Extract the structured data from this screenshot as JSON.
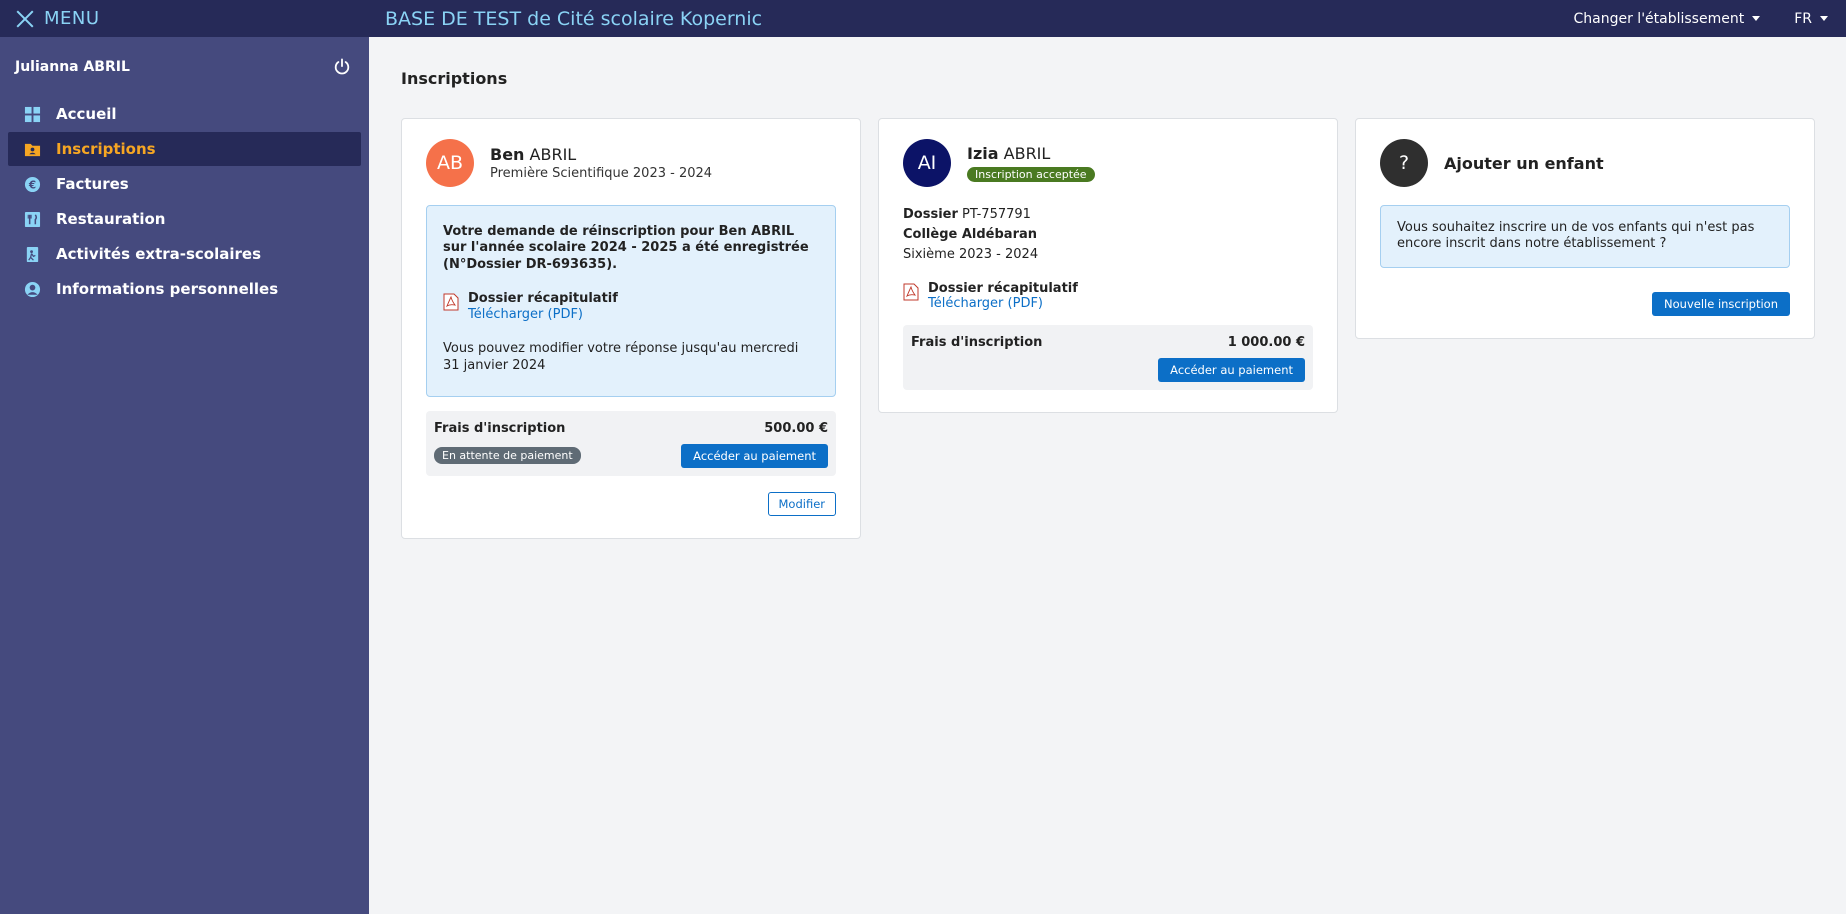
{
  "sidebar": {
    "menu_label": "MENU",
    "user_name": "Julianna ABRIL",
    "items": [
      {
        "label": "Accueil",
        "icon": "dashboard-icon"
      },
      {
        "label": "Inscriptions",
        "icon": "folder-user-icon",
        "active": true
      },
      {
        "label": "Factures",
        "icon": "euro-coin-icon"
      },
      {
        "label": "Restauration",
        "icon": "restaurant-icon"
      },
      {
        "label": "Activités extra-scolaires",
        "icon": "activity-icon"
      },
      {
        "label": "Informations personnelles",
        "icon": "person-icon"
      }
    ]
  },
  "topbar": {
    "title": "BASE DE TEST de Cité scolaire Kopernic",
    "change_school": "Changer l'établissement",
    "language": "FR"
  },
  "main": {
    "title": "Inscriptions",
    "cards": [
      {
        "initials": "AB",
        "first_name": "Ben",
        "last_name": "ABRIL",
        "class_year": "Première Scientifique 2023 - 2024",
        "message": "Votre demande de réinscription pour Ben ABRIL sur l'année scolaire 2024 - 2025 a été enregistrée (N°Dossier DR-693635).",
        "doc_title": "Dossier récapitulatif",
        "doc_link": "Télécharger (PDF)",
        "note": "Vous pouvez modifier votre réponse jusqu'au mercredi 31 janvier 2024",
        "fee_label": "Frais d'inscription",
        "fee_amount": "500.00 €",
        "fee_status": "En attente de paiement",
        "pay_button": "Accéder au paiement",
        "modify_button": "Modifier"
      },
      {
        "initials": "AI",
        "first_name": "Izia",
        "last_name": "ABRIL",
        "status_badge": "Inscription acceptée",
        "file_label": "Dossier",
        "file_number": "PT-757791",
        "school": "Collège Aldébaran",
        "class_year": "Sixième 2023 - 2024",
        "doc_title": "Dossier récapitulatif",
        "doc_link": "Télécharger (PDF)",
        "fee_label": "Frais d'inscription",
        "fee_amount": "1 000.00 €",
        "pay_button": "Accéder au paiement"
      },
      {
        "initials": "?",
        "title": "Ajouter un enfant",
        "message": "Vous souhaitez inscrire un de vos enfants qui n'est pas encore inscrit dans notre établissement ?",
        "button": "Nouvelle inscription"
      }
    ]
  },
  "colors": {
    "sidebar_bg": "#454a7e",
    "topbar_bg": "#262a58",
    "accent": "#8ad3f5",
    "active_text": "#f6a623",
    "primary": "#0c6fc7"
  }
}
